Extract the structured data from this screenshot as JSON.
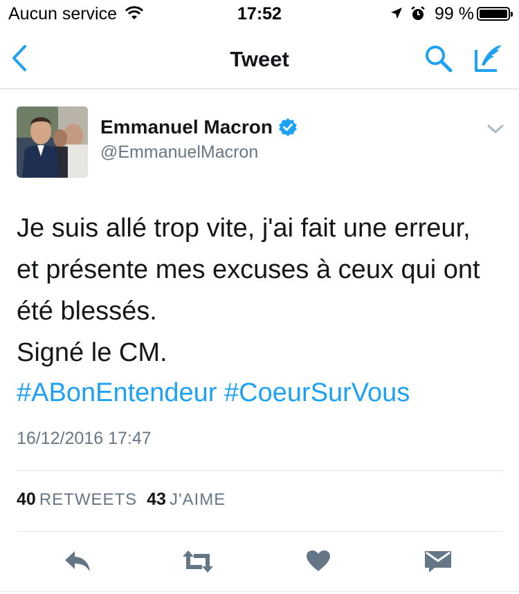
{
  "status_bar": {
    "carrier": "Aucun service",
    "time": "17:52",
    "battery_percent": "99 %",
    "icons": [
      "wifi-icon",
      "location-arrow-icon",
      "alarm-icon",
      "battery-icon"
    ]
  },
  "nav": {
    "title": "Tweet",
    "icons": [
      "back-chevron-icon",
      "search-icon",
      "compose-icon"
    ],
    "accent_color": "#1da1f2"
  },
  "tweet": {
    "author_name": "Emmanuel Macron",
    "author_handle": "@EmmanuelMacron",
    "verified": true,
    "text_lines": [
      "Je suis allé trop vite, j'ai fait une erreur,",
      "et présente mes excuses à ceux qui ont",
      "été blessés.",
      "Signé le CM."
    ],
    "hashtags": [
      "#ABonEntendeur",
      "#CoeurSurVous"
    ],
    "timestamp": "16/12/2016 17:47",
    "retweets_count": "40",
    "retweets_label": "RETWEETS",
    "likes_count": "43",
    "likes_label": "J'AIME"
  },
  "actions": [
    "reply-icon",
    "retweet-icon",
    "like-heart-icon",
    "direct-message-icon"
  ],
  "colors": {
    "text": "#14171a",
    "secondary": "#657786",
    "link": "#1da1f2",
    "action_icon": "#657786"
  }
}
